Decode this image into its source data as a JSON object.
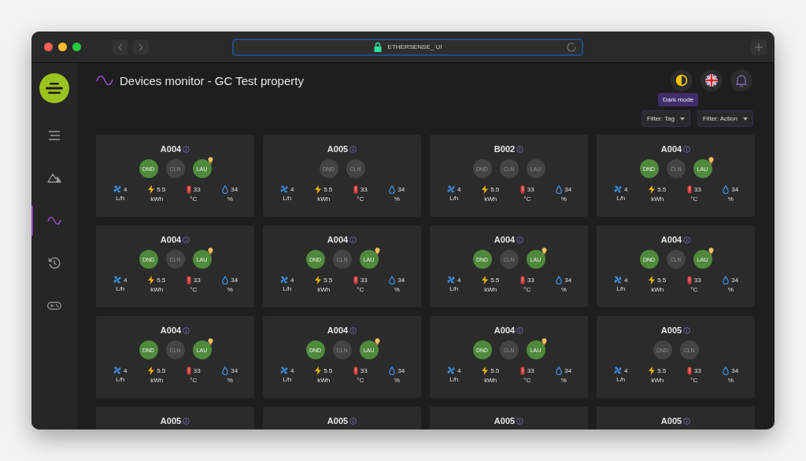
{
  "browser": {
    "address": "ETHERSENSE_ UI"
  },
  "sidebar": {
    "items": [
      {
        "kind": "list",
        "selected": false
      },
      {
        "kind": "mountain",
        "selected": false
      },
      {
        "kind": "wave",
        "selected": true
      },
      {
        "kind": "history",
        "selected": false
      },
      {
        "kind": "gamepad",
        "selected": false
      }
    ]
  },
  "header": {
    "title": "Devices monitor - GC Test property",
    "tooltip": "Dark mode"
  },
  "filters": [
    {
      "label": "Filter: Tag"
    },
    {
      "label": "Filter: Action"
    }
  ],
  "devices": [
    {
      "name": "A004",
      "badges": [
        {
          "label": "DND",
          "on": true,
          "alert": false
        },
        {
          "label": "CLN",
          "on": false,
          "alert": false
        },
        {
          "label": "LAU",
          "on": true,
          "alert": true
        }
      ],
      "metrics": [
        {
          "kind": "flow",
          "value": "4",
          "unit": "L/h"
        },
        {
          "kind": "energy",
          "value": "5.5",
          "unit": "kWh"
        },
        {
          "kind": "temperature",
          "value": "33",
          "unit": "°C"
        },
        {
          "kind": "humidity",
          "value": "34",
          "unit": "%"
        }
      ]
    },
    {
      "name": "A005",
      "badges": [
        {
          "label": "DND",
          "on": false,
          "alert": false
        },
        {
          "label": "CLN",
          "on": false,
          "alert": false
        }
      ],
      "metrics": [
        {
          "kind": "flow",
          "value": "4",
          "unit": "L/h"
        },
        {
          "kind": "energy",
          "value": "5.5",
          "unit": "kWh"
        },
        {
          "kind": "temperature",
          "value": "33",
          "unit": "°C"
        },
        {
          "kind": "humidity",
          "value": "34",
          "unit": "%"
        }
      ]
    },
    {
      "name": "B002",
      "badges": [
        {
          "label": "DND",
          "on": false,
          "alert": false
        },
        {
          "label": "CLN",
          "on": false,
          "alert": false
        },
        {
          "label": "LAU",
          "on": false,
          "alert": false
        }
      ],
      "metrics": [
        {
          "kind": "flow",
          "value": "4",
          "unit": "L/h"
        },
        {
          "kind": "energy",
          "value": "5.5",
          "unit": "kWh"
        },
        {
          "kind": "temperature",
          "value": "33",
          "unit": "°C"
        },
        {
          "kind": "humidity",
          "value": "34",
          "unit": "%"
        }
      ]
    },
    {
      "name": "A004",
      "badges": [
        {
          "label": "DND",
          "on": true,
          "alert": false
        },
        {
          "label": "CLN",
          "on": false,
          "alert": false
        },
        {
          "label": "LAU",
          "on": true,
          "alert": true
        }
      ],
      "metrics": [
        {
          "kind": "flow",
          "value": "4",
          "unit": "L/h"
        },
        {
          "kind": "energy",
          "value": "5.5",
          "unit": "kWh"
        },
        {
          "kind": "temperature",
          "value": "33",
          "unit": "°C"
        },
        {
          "kind": "humidity",
          "value": "34",
          "unit": "%"
        }
      ]
    },
    {
      "name": "A004",
      "badges": [
        {
          "label": "DND",
          "on": true,
          "alert": false
        },
        {
          "label": "CLN",
          "on": false,
          "alert": false
        },
        {
          "label": "LAU",
          "on": true,
          "alert": true
        }
      ],
      "metrics": [
        {
          "kind": "flow",
          "value": "4",
          "unit": "L/h"
        },
        {
          "kind": "energy",
          "value": "5.5",
          "unit": "kWh"
        },
        {
          "kind": "temperature",
          "value": "33",
          "unit": "°C"
        },
        {
          "kind": "humidity",
          "value": "34",
          "unit": "%"
        }
      ]
    },
    {
      "name": "A004",
      "badges": [
        {
          "label": "DND",
          "on": true,
          "alert": false
        },
        {
          "label": "CLN",
          "on": false,
          "alert": false
        },
        {
          "label": "LAU",
          "on": true,
          "alert": true
        }
      ],
      "metrics": [
        {
          "kind": "flow",
          "value": "4",
          "unit": "L/h"
        },
        {
          "kind": "energy",
          "value": "5.5",
          "unit": "kWh"
        },
        {
          "kind": "temperature",
          "value": "33",
          "unit": "°C"
        },
        {
          "kind": "humidity",
          "value": "34",
          "unit": "%"
        }
      ]
    },
    {
      "name": "A004",
      "badges": [
        {
          "label": "DND",
          "on": true,
          "alert": false
        },
        {
          "label": "CLN",
          "on": false,
          "alert": false
        },
        {
          "label": "LAU",
          "on": true,
          "alert": true
        }
      ],
      "metrics": [
        {
          "kind": "flow",
          "value": "4",
          "unit": "L/h"
        },
        {
          "kind": "energy",
          "value": "5.5",
          "unit": "kWh"
        },
        {
          "kind": "temperature",
          "value": "33",
          "unit": "°C"
        },
        {
          "kind": "humidity",
          "value": "34",
          "unit": "%"
        }
      ]
    },
    {
      "name": "A004",
      "badges": [
        {
          "label": "DND",
          "on": true,
          "alert": false
        },
        {
          "label": "CLN",
          "on": false,
          "alert": false
        },
        {
          "label": "LAU",
          "on": true,
          "alert": true
        }
      ],
      "metrics": [
        {
          "kind": "flow",
          "value": "4",
          "unit": "L/h"
        },
        {
          "kind": "energy",
          "value": "5.5",
          "unit": "kWh"
        },
        {
          "kind": "temperature",
          "value": "33",
          "unit": "°C"
        },
        {
          "kind": "humidity",
          "value": "34",
          "unit": "%"
        }
      ]
    },
    {
      "name": "A004",
      "badges": [
        {
          "label": "DND",
          "on": true,
          "alert": false
        },
        {
          "label": "CLN",
          "on": false,
          "alert": false
        },
        {
          "label": "LAU",
          "on": true,
          "alert": true
        }
      ],
      "metrics": [
        {
          "kind": "flow",
          "value": "4",
          "unit": "L/h"
        },
        {
          "kind": "energy",
          "value": "5.5",
          "unit": "kWh"
        },
        {
          "kind": "temperature",
          "value": "33",
          "unit": "°C"
        },
        {
          "kind": "humidity",
          "value": "34",
          "unit": "%"
        }
      ]
    },
    {
      "name": "A004",
      "badges": [
        {
          "label": "DND",
          "on": true,
          "alert": false
        },
        {
          "label": "CLN",
          "on": false,
          "alert": false
        },
        {
          "label": "LAU",
          "on": true,
          "alert": true
        }
      ],
      "metrics": [
        {
          "kind": "flow",
          "value": "4",
          "unit": "L/h"
        },
        {
          "kind": "energy",
          "value": "5.5",
          "unit": "kWh"
        },
        {
          "kind": "temperature",
          "value": "33",
          "unit": "°C"
        },
        {
          "kind": "humidity",
          "value": "34",
          "unit": "%"
        }
      ]
    },
    {
      "name": "A004",
      "badges": [
        {
          "label": "DND",
          "on": true,
          "alert": false
        },
        {
          "label": "CLN",
          "on": false,
          "alert": false
        },
        {
          "label": "LAU",
          "on": true,
          "alert": true
        }
      ],
      "metrics": [
        {
          "kind": "flow",
          "value": "4",
          "unit": "L/h"
        },
        {
          "kind": "energy",
          "value": "5.5",
          "unit": "kWh"
        },
        {
          "kind": "temperature",
          "value": "33",
          "unit": "°C"
        },
        {
          "kind": "humidity",
          "value": "34",
          "unit": "%"
        }
      ]
    },
    {
      "name": "A005",
      "badges": [
        {
          "label": "DND",
          "on": false,
          "alert": false
        },
        {
          "label": "CLN",
          "on": false,
          "alert": false
        }
      ],
      "metrics": [
        {
          "kind": "flow",
          "value": "4",
          "unit": "L/h"
        },
        {
          "kind": "energy",
          "value": "5.5",
          "unit": "kWh"
        },
        {
          "kind": "temperature",
          "value": "33",
          "unit": "°C"
        },
        {
          "kind": "humidity",
          "value": "34",
          "unit": "%"
        }
      ]
    },
    {
      "name": "A005"
    },
    {
      "name": "A005"
    },
    {
      "name": "A005"
    },
    {
      "name": "A005"
    }
  ]
}
